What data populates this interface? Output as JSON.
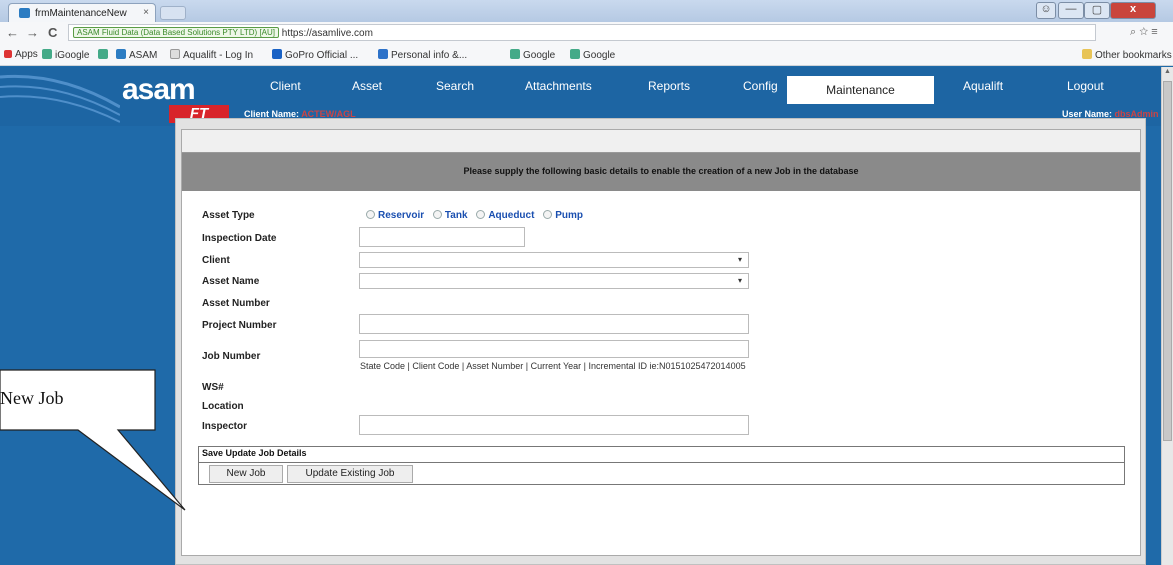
{
  "browser": {
    "tab_title": "frmMaintenanceNew",
    "tab_close": "×",
    "ev_label": "ASAM Fluid Data (Data Based Solutions PTY LTD) [AU]",
    "url": "https://asamlive.com",
    "nav_back": "←",
    "nav_forward": "→",
    "nav_reload": "C",
    "toolbar_icons": "⌕ ☆ ≡",
    "win_user": "☺",
    "win_min": "—",
    "win_max": "▢",
    "win_close": "x",
    "bookmarks": [
      "Apps",
      "iGoogle",
      "ASAM",
      "Aqualift - Log In",
      "GoPro Official ...",
      "Personal info &...",
      "Google",
      "Google"
    ],
    "other_bookmarks": "Other bookmarks"
  },
  "header": {
    "logo_main": "asam",
    "logo_sub": "FT",
    "menu": [
      "Client",
      "Asset",
      "Search",
      "Attachments",
      "Reports",
      "Config",
      "Maintenance",
      "Aqualift",
      "Logout"
    ],
    "active_menu": "Maintenance",
    "client_label": "Client Name:",
    "client_value": "ACTEW/AGL",
    "user_label": "User Name:",
    "user_value": "dbsAdmin"
  },
  "form": {
    "instructions": "Please supply the following basic details to enable the creation of a new Job in the database",
    "labels": {
      "asset_type": "Asset Type",
      "inspection_date": "Inspection Date",
      "client": "Client",
      "asset_name": "Asset Name",
      "asset_number": "Asset Number",
      "project_number": "Project Number",
      "job_number": "Job Number",
      "ws": "WS#",
      "location": "Location",
      "inspector": "Inspector"
    },
    "asset_types": [
      "Reservoir",
      "Tank",
      "Aqueduct",
      "Pump"
    ],
    "select_arrow": "▾",
    "job_number_hint": "State Code | Client Code | Asset Number | Current Year | Incremental ID ie:N0151025472014005",
    "section_title": "Save Update Job Details",
    "new_job_button": "New Job",
    "update_job_button": "Update Existing Job"
  },
  "callout": {
    "text": "New Job"
  },
  "colors": {
    "app_bg": "#1f6aa9",
    "brand_red": "#d8242a",
    "radio_text": "#1a4fb0"
  }
}
